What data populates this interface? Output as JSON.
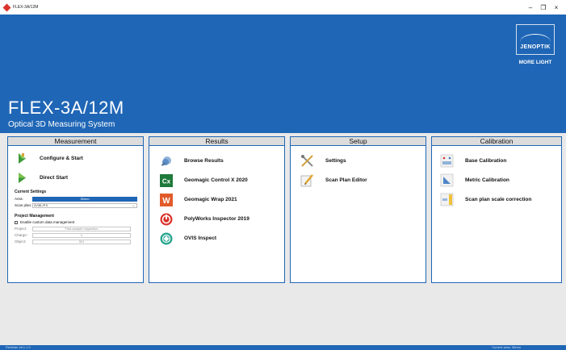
{
  "window": {
    "title": "FLEX-3A/12M",
    "controls": [
      "–",
      "❐",
      "×"
    ]
  },
  "brand": {
    "name": "JENOPTIK",
    "tagline": "MORE LIGHT"
  },
  "product": {
    "name": "FLEX-3A/12M",
    "subtitle": "Optical 3D Measuring System"
  },
  "panels": {
    "measurement": {
      "title": "Measurement",
      "actions": [
        {
          "label": "Configure & Start",
          "icon": "configure-start-icon"
        },
        {
          "label": "Direct Start",
          "icon": "direct-start-icon"
        }
      ],
      "current_settings": {
        "title": "Current Settings",
        "area_label": "Area:",
        "area_value": "30mm",
        "scan_plan_label": "Scan plan:",
        "scan_plan_value": "4V/8L/P.0"
      },
      "project_management": {
        "title": "Project Management",
        "enable_label": "Enable custom data management",
        "fields": [
          {
            "label": "Project:",
            "value": "First-sample inspection"
          },
          {
            "label": "Charge:",
            "value": "1"
          },
          {
            "label": "Object:",
            "value": "321"
          }
        ]
      }
    },
    "results": {
      "title": "Results",
      "actions": [
        {
          "label": "Browse Results",
          "icon": "browse-results-icon"
        },
        {
          "label": "Geomagic Control X 2020",
          "icon": "geomagic-control-x-icon"
        },
        {
          "label": "Geomagic Wrap 2021",
          "icon": "geomagic-wrap-icon"
        },
        {
          "label": "PolyWorks Inspector 2019",
          "icon": "polyworks-icon"
        },
        {
          "label": "OVIS Inspect",
          "icon": "ovis-inspect-icon"
        }
      ]
    },
    "setup": {
      "title": "Setup",
      "actions": [
        {
          "label": "Settings",
          "icon": "settings-tools-icon"
        },
        {
          "label": "Scan Plan Editor",
          "icon": "scan-plan-editor-icon"
        }
      ]
    },
    "calibration": {
      "title": "Calibration",
      "actions": [
        {
          "label": "Base Calibration",
          "icon": "base-calibration-icon"
        },
        {
          "label": "Metric Calibration",
          "icon": "metric-calibration-icon"
        },
        {
          "label": "Scan plan scale correction",
          "icon": "scan-plan-scale-icon"
        }
      ]
    }
  },
  "status": {
    "left": "FlexMan v6.1.1.0",
    "right": "Current area: 30mm"
  },
  "colors": {
    "accent": "#1f66b6",
    "panel_header": "#dcdcdc",
    "background": "#e9e9e9"
  }
}
